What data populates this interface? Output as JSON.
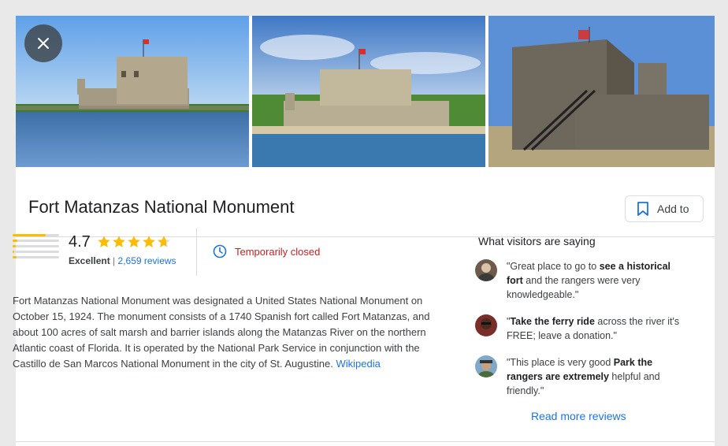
{
  "place": {
    "title": "Fort Matanzas National Monument",
    "add_label": "Add to"
  },
  "photos": [
    {
      "name": "fort-photo-1"
    },
    {
      "name": "fort-photo-2"
    },
    {
      "name": "fort-photo-3"
    }
  ],
  "rating": {
    "score": "4.7",
    "stars_value": 4.7,
    "stars_max": 5,
    "label": "Excellent",
    "separator": "|",
    "reviews": "2,659 reviews",
    "distribution": [
      0.72,
      0.1,
      0.06,
      0.04,
      0.08
    ]
  },
  "status": {
    "text": "Temporarily closed",
    "color": "#c5221f"
  },
  "description": {
    "text": "Fort Matanzas National Monument was designated a United States National Monument on October 15, 1924. The monument consists of a 1740 Spanish fort called Fort Matanzas, and about 100 acres of salt marsh and barrier islands along the Matanzas River on the northern Atlantic coast of Florida. It is operated by the National Park Service in conjunction with the Castillo de San Marcos National Monument in the city of St. Augustine.",
    "link": "Wikipedia"
  },
  "visitors": {
    "title": "What visitors are saying",
    "reviews": [
      {
        "pre": "\"Great place to go to ",
        "bold": "see a historical fort",
        "post": " and the rangers were very knowledgeable.\""
      },
      {
        "pre": "\"",
        "bold": "Take the ferry ride",
        "post": " across the river it's FREE; leave a donation.\""
      },
      {
        "pre": "\"This place is very good ",
        "bold": "Park the rangers are extremely",
        "post": " helpful and friendly.\""
      }
    ],
    "read_more": "Read more reviews"
  },
  "colors": {
    "accent": "#1a73e8",
    "star": "#fbbc04",
    "closed": "#c5221f"
  }
}
